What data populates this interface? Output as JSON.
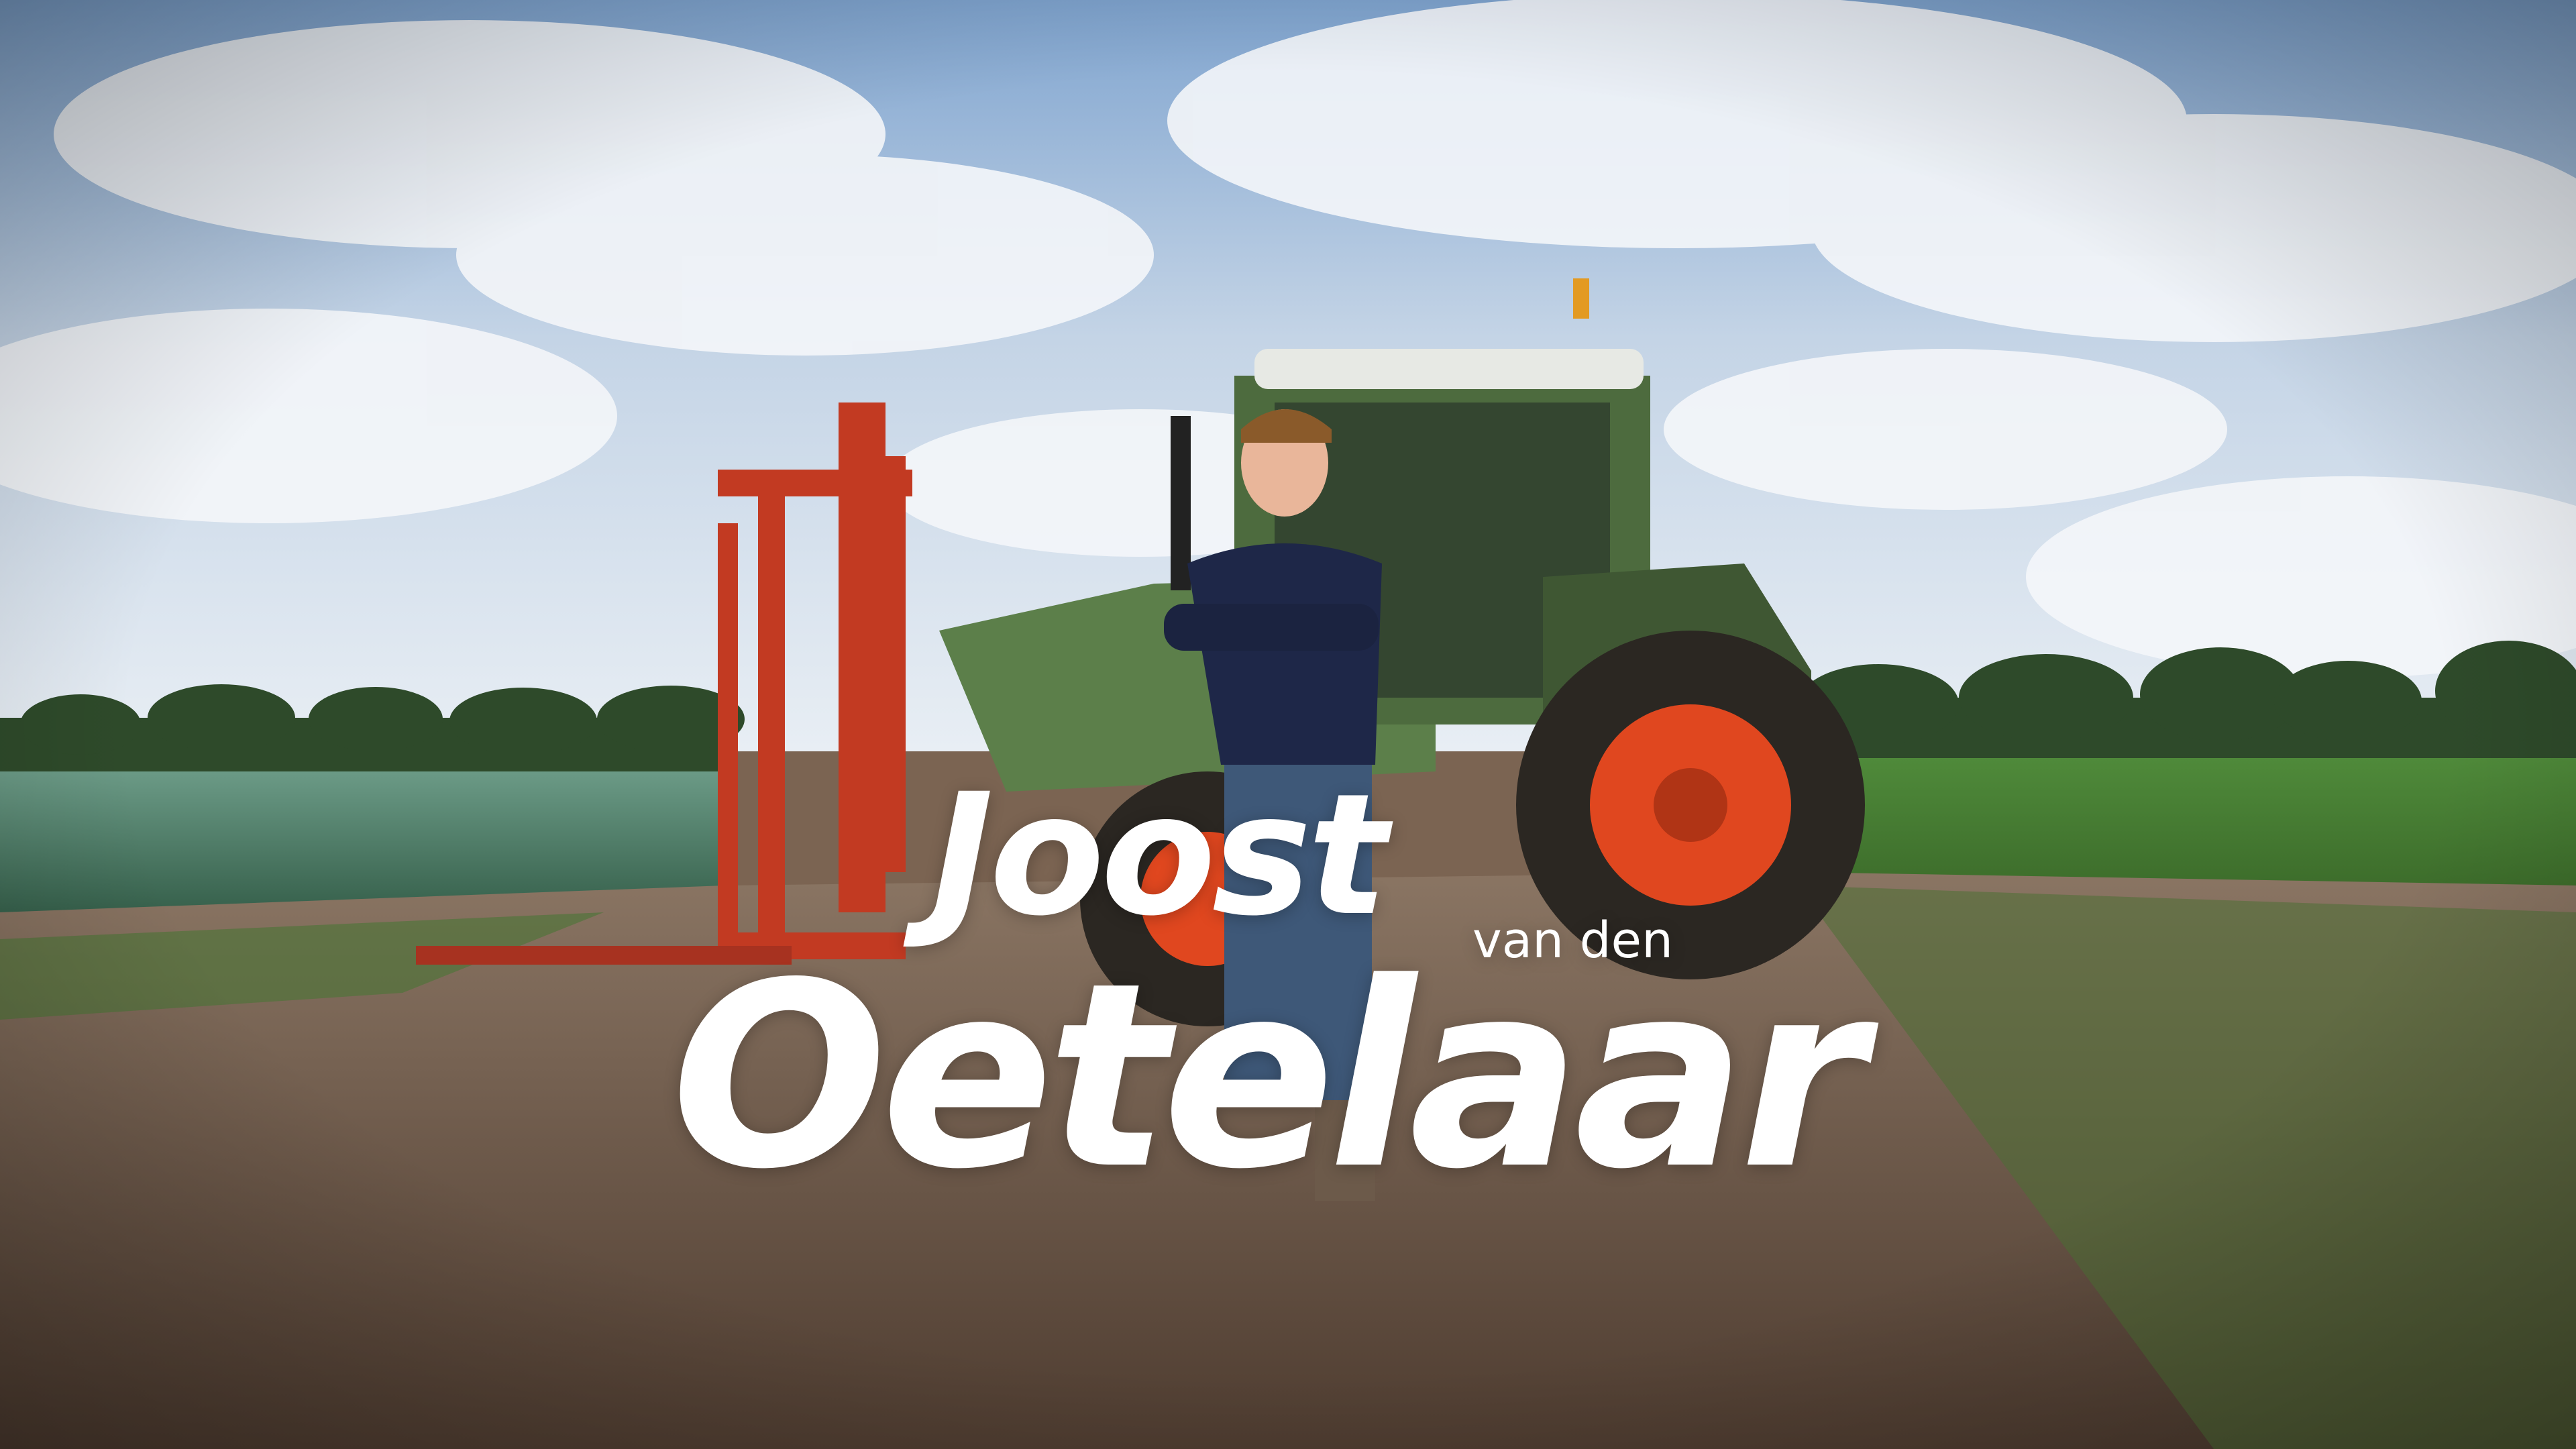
{
  "title": {
    "first": "Joost",
    "middle": "van den",
    "last": "Oetelaar"
  },
  "scene": {
    "description_colors": {
      "sky_top": "#7fa4cf",
      "sky_bottom": "#dfe8f1",
      "tractor_green": "#5c7f4a",
      "loader_red": "#c23a22",
      "rim_orange": "#e0471f",
      "soil": "#6a5443",
      "crop_left": "#4d7a63",
      "crop_right": "#4f8a3a"
    }
  }
}
